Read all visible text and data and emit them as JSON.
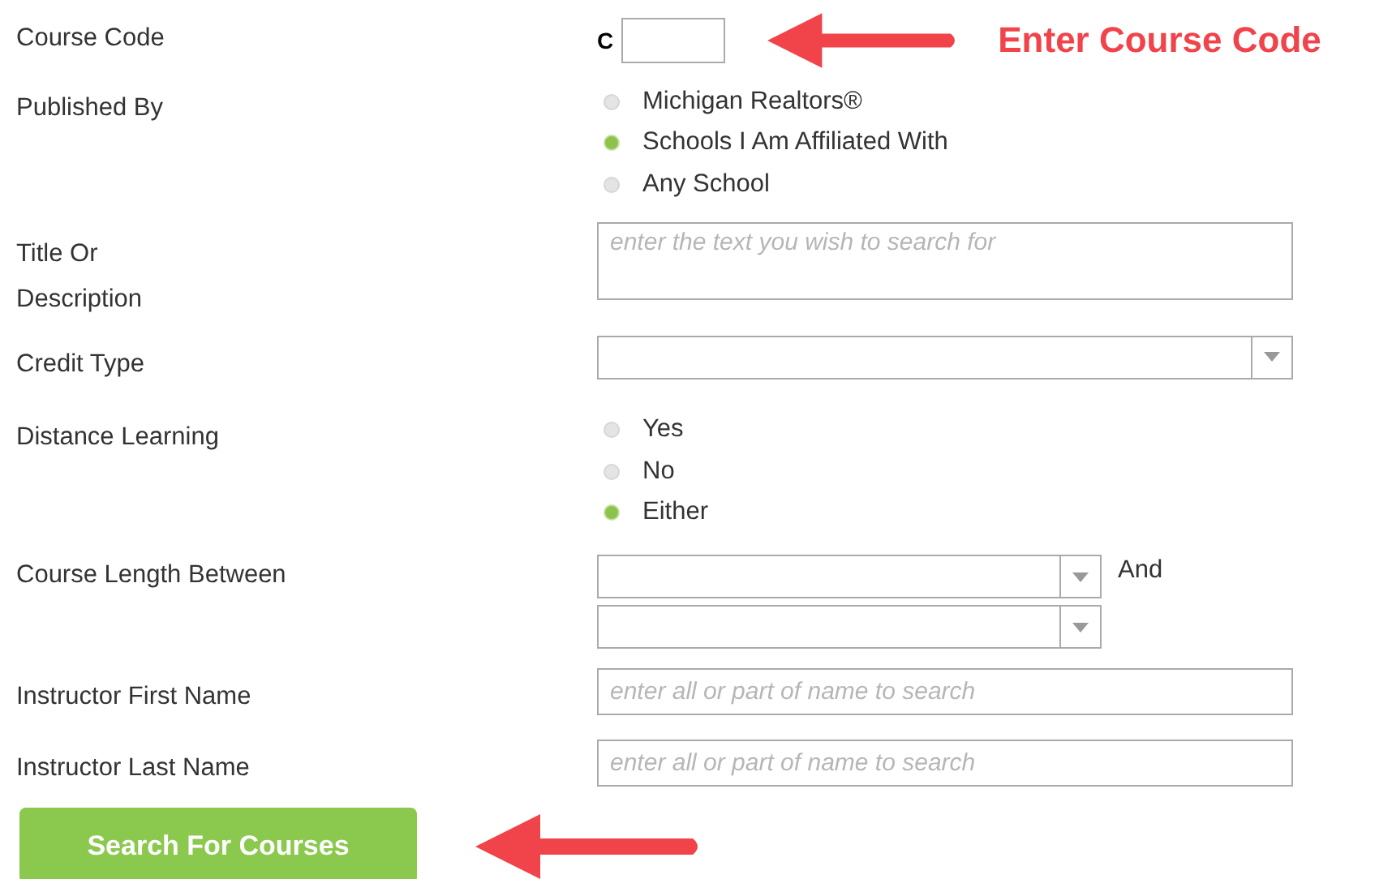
{
  "fields": [
    {
      "kind": "code",
      "label": "Course Code",
      "prefix": "C",
      "callout": "Enter Course Code"
    },
    {
      "kind": "radios",
      "label": "Published By",
      "options": [
        {
          "label": "Michigan Realtors®",
          "selected": false
        },
        {
          "label": "Schools I Am Affiliated With",
          "selected": true
        },
        {
          "label": "Any School",
          "selected": false
        }
      ]
    },
    {
      "kind": "textarea",
      "label": "Title Or Description",
      "placeholder": "enter the text you wish to search for"
    },
    {
      "kind": "select",
      "label": "Credit Type"
    },
    {
      "kind": "radios",
      "label": "Distance Learning",
      "options": [
        {
          "label": "Yes",
          "selected": false
        },
        {
          "label": "No",
          "selected": false
        },
        {
          "label": "Either",
          "selected": true
        }
      ]
    },
    {
      "kind": "range",
      "label": "Course Length Between",
      "joiner": "And"
    },
    {
      "kind": "text",
      "label": "Instructor First Name",
      "placeholder": "enter all or part of name to search"
    },
    {
      "kind": "text",
      "label": "Instructor Last Name",
      "placeholder": "enter all or part of name to search"
    }
  ],
  "submit": {
    "label": "Search For Courses"
  }
}
